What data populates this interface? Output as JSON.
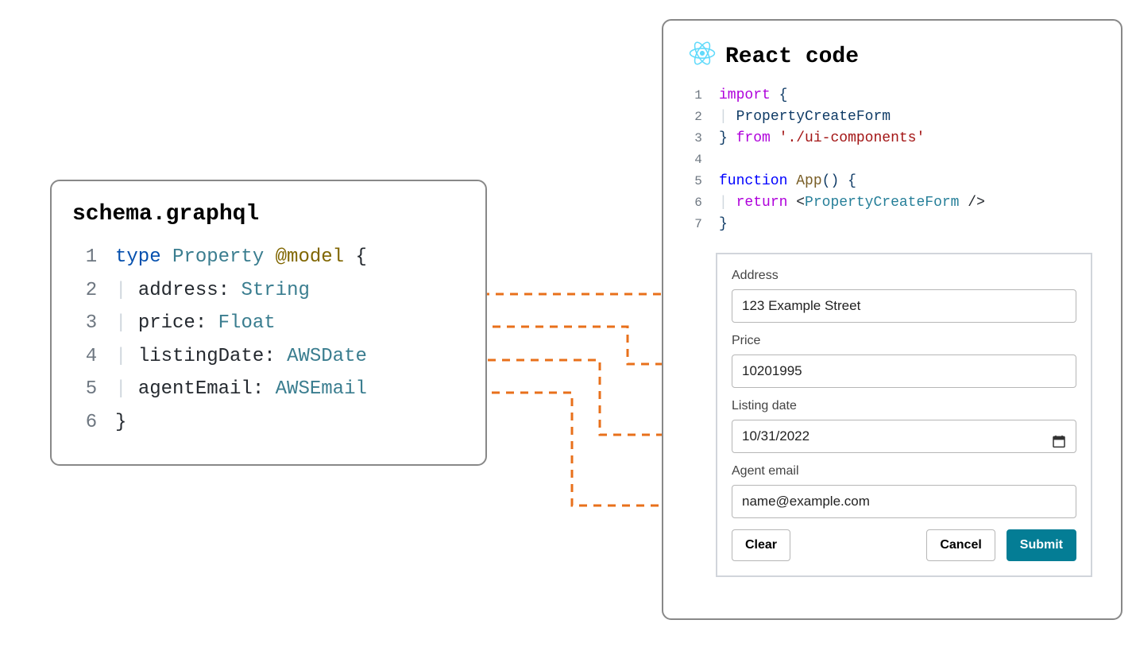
{
  "schema": {
    "title": "schema.graphql",
    "lines": [
      {
        "n": "1",
        "tokens": [
          [
            "keyword",
            "type"
          ],
          [
            "space",
            " "
          ],
          [
            "type",
            "Property"
          ],
          [
            "space",
            " "
          ],
          [
            "decor",
            "@model"
          ],
          [
            "space",
            " "
          ],
          [
            "punct",
            "{"
          ]
        ]
      },
      {
        "n": "2",
        "tokens": [
          [
            "indent",
            "  "
          ],
          [
            "field",
            "address"
          ],
          [
            "punct",
            ": "
          ],
          [
            "ftype",
            "String"
          ]
        ]
      },
      {
        "n": "3",
        "tokens": [
          [
            "indent",
            "  "
          ],
          [
            "field",
            "price"
          ],
          [
            "punct",
            ": "
          ],
          [
            "ftype",
            "Float"
          ]
        ]
      },
      {
        "n": "4",
        "tokens": [
          [
            "indent",
            "  "
          ],
          [
            "field",
            "listingDate"
          ],
          [
            "punct",
            ": "
          ],
          [
            "ftype",
            "AWSDate"
          ]
        ]
      },
      {
        "n": "5",
        "tokens": [
          [
            "indent",
            "  "
          ],
          [
            "field",
            "agentEmail"
          ],
          [
            "punct",
            ": "
          ],
          [
            "ftype",
            "AWSEmail"
          ]
        ]
      },
      {
        "n": "6",
        "tokens": [
          [
            "punct",
            "}"
          ]
        ]
      }
    ]
  },
  "react": {
    "title": "React code",
    "lines": [
      {
        "n": "1",
        "tokens": [
          [
            "import",
            "import"
          ],
          [
            "space",
            " "
          ],
          [
            "brace",
            "{"
          ]
        ]
      },
      {
        "n": "2",
        "tokens": [
          [
            "bar",
            "  "
          ],
          [
            "ident",
            "PropertyCreateForm"
          ]
        ]
      },
      {
        "n": "3",
        "tokens": [
          [
            "brace",
            "}"
          ],
          [
            "space",
            " "
          ],
          [
            "from",
            "from"
          ],
          [
            "space",
            " "
          ],
          [
            "string",
            "'./ui-components'"
          ]
        ]
      },
      {
        "n": "4",
        "tokens": []
      },
      {
        "n": "5",
        "tokens": [
          [
            "func",
            "function"
          ],
          [
            "space",
            " "
          ],
          [
            "fname",
            "App"
          ],
          [
            "brace",
            "()"
          ],
          [
            "space",
            " "
          ],
          [
            "brace",
            "{"
          ]
        ]
      },
      {
        "n": "6",
        "tokens": [
          [
            "bar",
            "  "
          ],
          [
            "return",
            "return"
          ],
          [
            "space",
            " "
          ],
          [
            "punct",
            "<"
          ],
          [
            "jsx",
            "PropertyCreateForm"
          ],
          [
            "space",
            " "
          ],
          [
            "punct",
            "/>"
          ]
        ]
      },
      {
        "n": "7",
        "tokens": [
          [
            "brace",
            "}"
          ]
        ]
      }
    ]
  },
  "form": {
    "address_label": "Address",
    "address_value": "123 Example Street",
    "price_label": "Price",
    "price_value": "10201995",
    "date_label": "Listing date",
    "date_value": "10/31/2022",
    "email_label": "Agent email",
    "email_value": "name@example.com",
    "clear": "Clear",
    "cancel": "Cancel",
    "submit": "Submit"
  },
  "colors": {
    "connector": "#e8701b",
    "accent_bar": "#e8701b",
    "react_logo": "#61dafb",
    "submit_bg": "#047d95"
  }
}
